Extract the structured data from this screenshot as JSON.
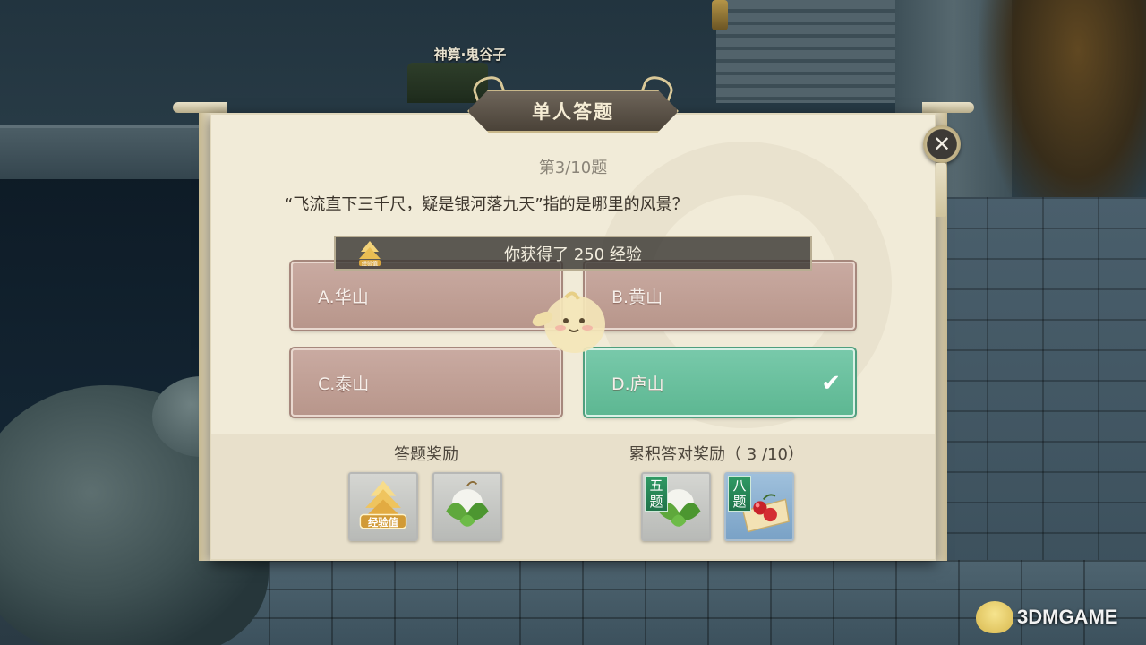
{
  "npc": {
    "name": "神算·鬼谷子"
  },
  "dialog": {
    "title": "单人答题",
    "question_number": "第3/10题",
    "question_text": "“飞流直下三千尺，疑是银河落九天”指的是哪里的风景？",
    "close_icon": "close-icon"
  },
  "exp_toast": {
    "text": "你获得了 250 经验",
    "icon_label": "经验值"
  },
  "options": [
    {
      "label": "A.华山",
      "state": "normal"
    },
    {
      "label": "B.黄山",
      "state": "normal"
    },
    {
      "label": "C.泰山",
      "state": "normal"
    },
    {
      "label": "D.庐山",
      "state": "correct"
    }
  ],
  "rewards": {
    "answer_reward_title": "答题奖励",
    "cumulative_reward_title": "累积答对奖励（ 3 /10）",
    "answer_items": [
      {
        "icon": "exp-icon",
        "label": "经验值"
      },
      {
        "icon": "zongzi-icon"
      }
    ],
    "cumulative_items": [
      {
        "icon": "zongzi-icon",
        "tag": [
          "五",
          "题"
        ]
      },
      {
        "icon": "cherry-plate-icon",
        "tag": [
          "八",
          "题"
        ]
      }
    ]
  },
  "watermark": {
    "text": "3DMGAME"
  },
  "colors": {
    "panel": "#f1ebd8",
    "option_normal": "#c9aaa1",
    "option_correct": "#6cc09f",
    "banner": "#5a5146"
  }
}
